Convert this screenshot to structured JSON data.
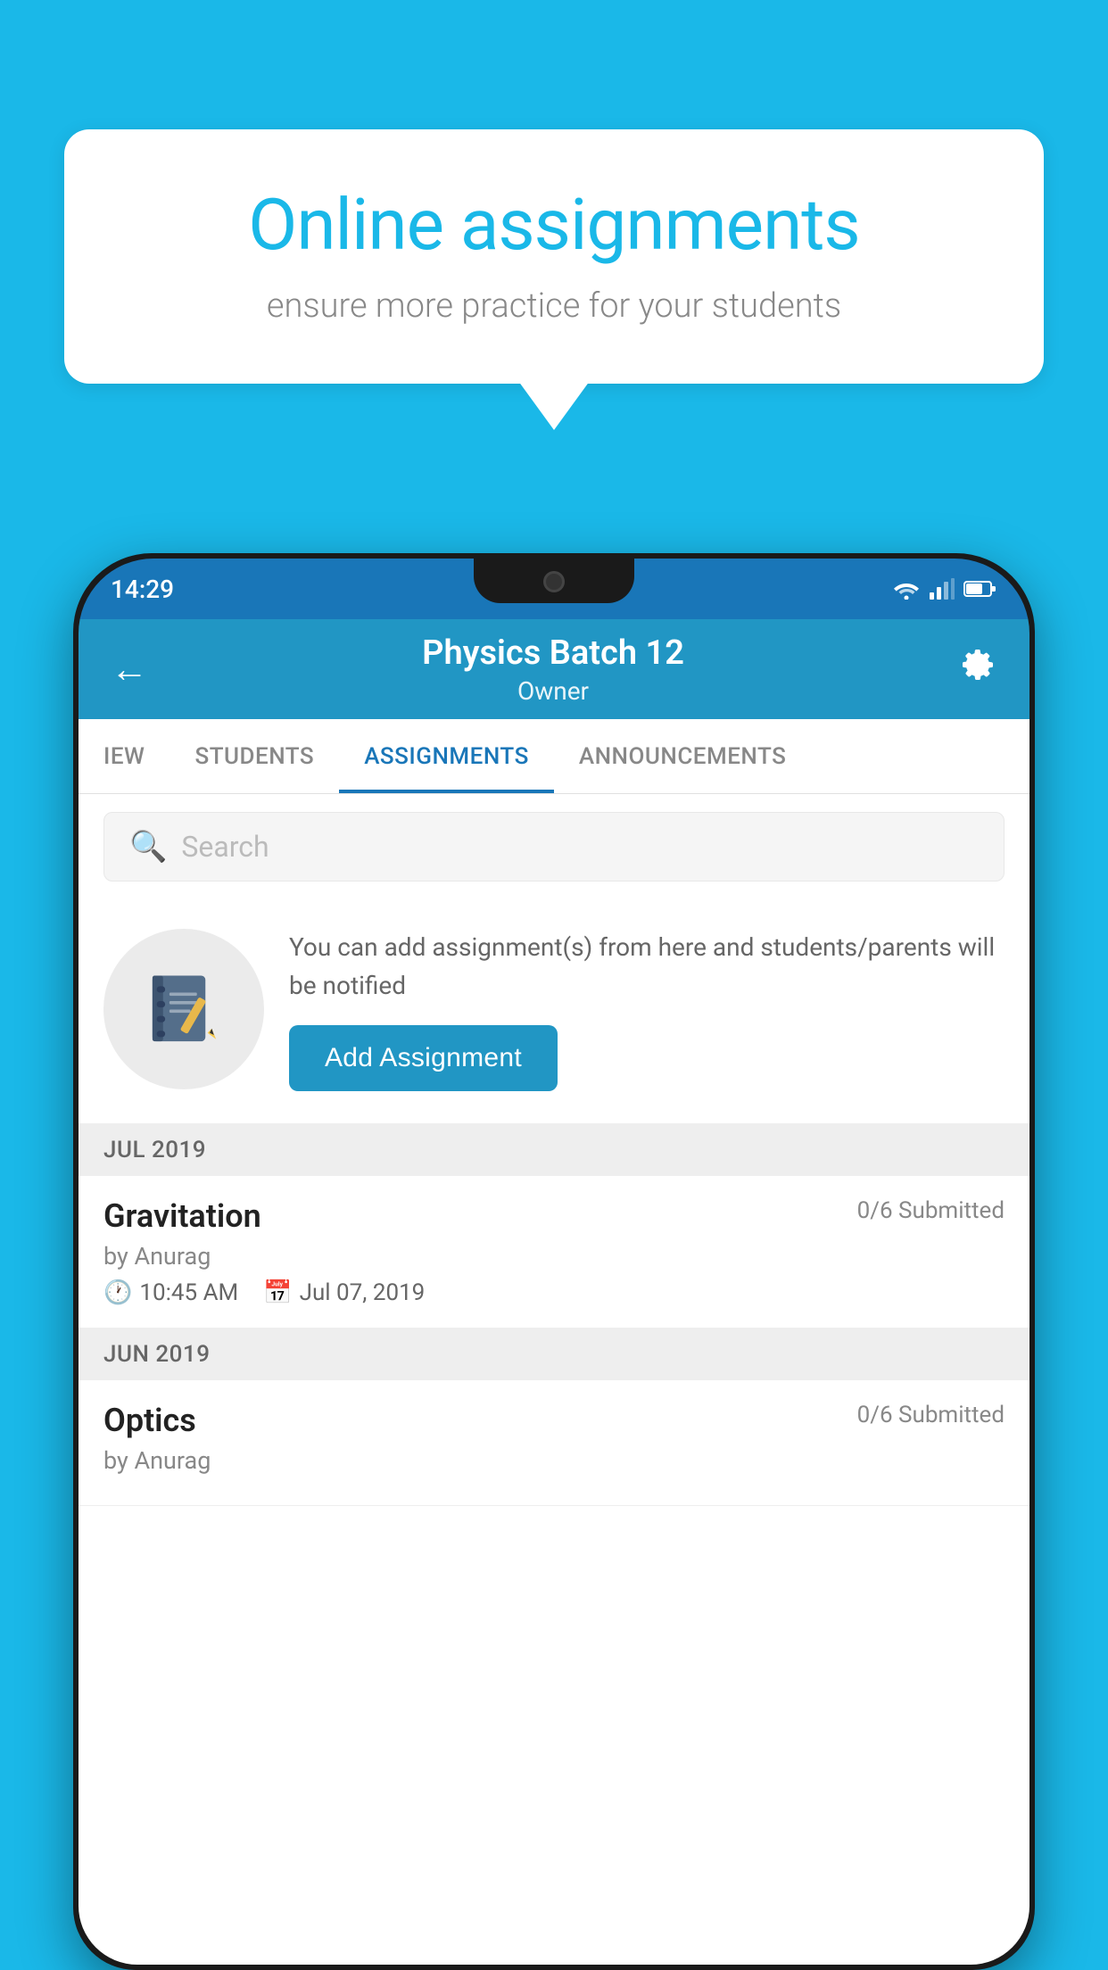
{
  "background_color": "#1ab8e8",
  "speech_bubble": {
    "title": "Online assignments",
    "subtitle": "ensure more practice for your students"
  },
  "status_bar": {
    "time": "14:29"
  },
  "app_header": {
    "title": "Physics Batch 12",
    "subtitle": "Owner",
    "back_label": "←",
    "settings_label": "⚙"
  },
  "tabs": [
    {
      "label": "IEW",
      "active": false
    },
    {
      "label": "STUDENTS",
      "active": false
    },
    {
      "label": "ASSIGNMENTS",
      "active": true
    },
    {
      "label": "ANNOUNCEMENTS",
      "active": false
    }
  ],
  "search": {
    "placeholder": "Search"
  },
  "promo": {
    "description": "You can add assignment(s) from here and students/parents will be notified",
    "button_label": "Add Assignment"
  },
  "sections": [
    {
      "label": "JUL 2019",
      "assignments": [
        {
          "title": "Gravitation",
          "submitted": "0/6 Submitted",
          "by": "by Anurag",
          "time": "10:45 AM",
          "date": "Jul 07, 2019"
        }
      ]
    },
    {
      "label": "JUN 2019",
      "assignments": [
        {
          "title": "Optics",
          "submitted": "0/6 Submitted",
          "by": "by Anurag",
          "time": "",
          "date": ""
        }
      ]
    }
  ]
}
